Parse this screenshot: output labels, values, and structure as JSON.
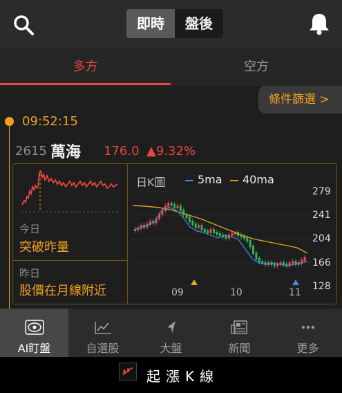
{
  "header": {
    "segments": [
      "即時",
      "盤後"
    ],
    "active_segment": 0
  },
  "tabs": [
    "多方",
    "空方"
  ],
  "filter_label": "條件篩選 >",
  "alert": {
    "time": "09:52:15",
    "code": "2615",
    "name": "萬海",
    "price": "176.0",
    "change": "▲9.32%",
    "today_label": "今日",
    "today_value": "突破昨量",
    "yesterday_label": "昨日",
    "yesterday_value": "股價在月線附近"
  },
  "chart_data": {
    "type": "candlestick",
    "title": "日K圖",
    "legend": [
      "5ma",
      "40ma"
    ],
    "y_ticks": [
      "279",
      "241",
      "204",
      "166",
      "128"
    ],
    "x_ticks": [
      "09",
      "10",
      "11"
    ],
    "ylim": [
      128,
      279
    ],
    "colors": {
      "up": "#e8463f",
      "down": "#2fb45a",
      "ma5": "#3a8ee8",
      "ma40": "#e0a020"
    }
  },
  "nav": [
    "AI盯盤",
    "自選股",
    "大盤",
    "新聞",
    "更多"
  ],
  "footer_brand": "起漲K線"
}
